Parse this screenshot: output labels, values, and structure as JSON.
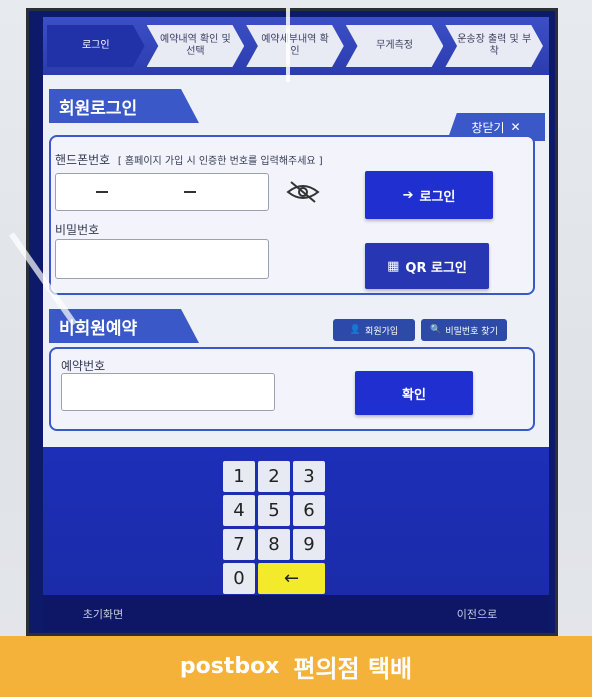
{
  "steps": [
    {
      "label": "로그인",
      "active": true
    },
    {
      "label": "예약내역 확인 및 선택",
      "active": false
    },
    {
      "label": "예약세부내역 확인",
      "active": false
    },
    {
      "label": "무게측정",
      "active": false
    },
    {
      "label": "운송장 출력 및 부착",
      "active": false
    }
  ],
  "member_login": {
    "title": "회원로그인",
    "close_label": "창닫기",
    "phone_label": "핸드폰번호",
    "phone_hint": "[ 홈페이지 가입 시 인증한 번호를 입력해주세요 ]",
    "password_label": "비밀번호",
    "login_label": "로그인",
    "qr_login_label": "QR 로그인"
  },
  "guest_reservation": {
    "title": "비회원예약",
    "signup_label": "회원가입",
    "find_password_label": "비밀번호 찾기",
    "reservation_no_label": "예약번호",
    "confirm_label": "확인"
  },
  "keypad": {
    "keys": [
      "1",
      "2",
      "3",
      "4",
      "5",
      "6",
      "7",
      "8",
      "9",
      "0"
    ],
    "backspace": "←"
  },
  "footer": {
    "home_label": "초기화면",
    "prev_label": "이전으로"
  },
  "branding": {
    "logo": "postbox",
    "service": "편의점 택배"
  },
  "colors": {
    "accent": "#3a58c8",
    "button": "#1f2fd0",
    "keypad_bg": "#1d2fb8",
    "backspace": "#f2ea2a",
    "brand": "#f4b23a"
  }
}
